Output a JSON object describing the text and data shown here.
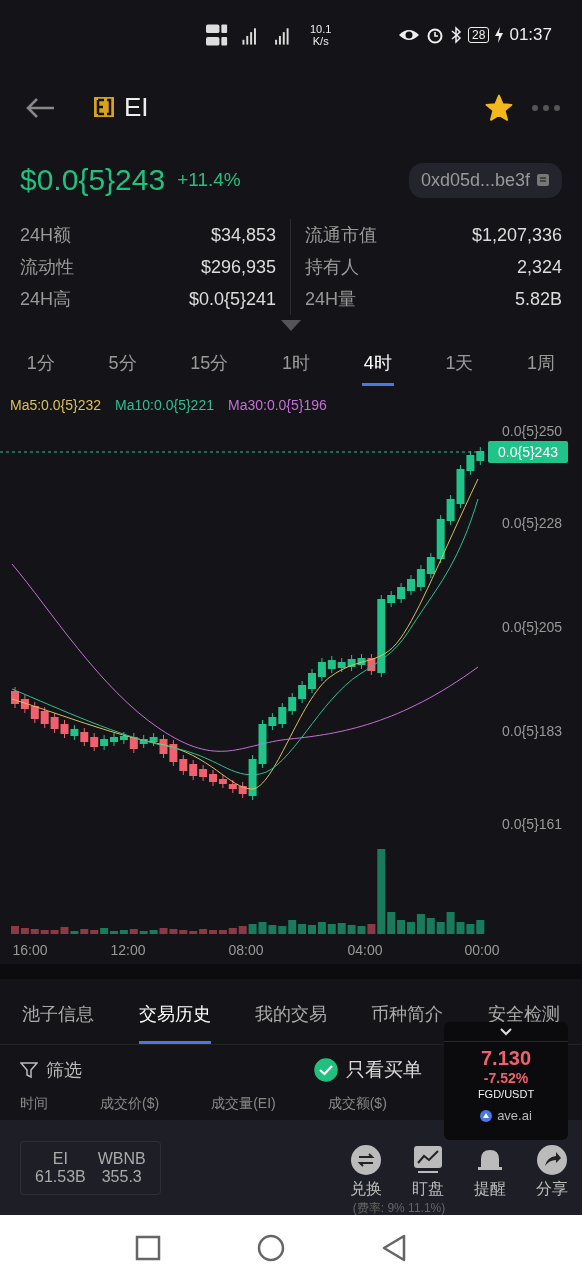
{
  "status_bar": {
    "network_speed": "10.1",
    "network_unit": "K/s",
    "battery": "28",
    "time": "01:37"
  },
  "header": {
    "token_symbol": "EI",
    "favorited": true
  },
  "price": {
    "value": "$0.0{5}243",
    "change": "+11.4%",
    "address": "0xd05d...be3f"
  },
  "stats": [
    {
      "label": "24H额",
      "value": "$34,853"
    },
    {
      "label": "流通市值",
      "value": "$1,207,336"
    },
    {
      "label": "流动性",
      "value": "$296,935"
    },
    {
      "label": "持有人",
      "value": "2,324"
    },
    {
      "label": "24H高",
      "value": "$0.0{5}241"
    },
    {
      "label": "24H量",
      "value": "5.82B"
    }
  ],
  "intervals": [
    {
      "label": "1分",
      "selected": false
    },
    {
      "label": "5分",
      "selected": false
    },
    {
      "label": "15分",
      "selected": false
    },
    {
      "label": "1时",
      "selected": false
    },
    {
      "label": "4时",
      "selected": true
    },
    {
      "label": "1天",
      "selected": false
    },
    {
      "label": "1周",
      "selected": false
    }
  ],
  "moving_averages": [
    {
      "label": "Ma5:0.0{5}232",
      "color": "#d9c15a"
    },
    {
      "label": "Ma10:0.0{5}221",
      "color": "#2fbf8f"
    },
    {
      "label": "Ma30:0.0{5}196",
      "color": "#c46fd6"
    }
  ],
  "chart": {
    "price_labels": [
      "0.0{5}250",
      "0.0{5}228",
      "0.0{5}205",
      "0.0{5}183",
      "0.0{5}161"
    ],
    "current_price": "0.0{5}243",
    "time_labels": [
      "16:00",
      "12:00",
      "08:00",
      "04:00",
      "00:00"
    ]
  },
  "detail_tabs": [
    {
      "label": "池子信息",
      "selected": false
    },
    {
      "label": "交易历史",
      "selected": true
    },
    {
      "label": "我的交易",
      "selected": false
    },
    {
      "label": "币种简介",
      "selected": false
    },
    {
      "label": "安全检测",
      "selected": false
    }
  ],
  "filter": {
    "label": "筛选",
    "buy_only_label": "只看买单",
    "buy_only": true
  },
  "columns": [
    "时间",
    "成交价($)",
    "成交量(EI)",
    "成交额($)"
  ],
  "balances": [
    {
      "symbol": "EI",
      "amount": "61.53B"
    },
    {
      "symbol": "WBNB",
      "amount": "355.3"
    }
  ],
  "actions": [
    {
      "label": "兑换",
      "kind": "swap"
    },
    {
      "label": "盯盘",
      "kind": "chart"
    },
    {
      "label": "提醒",
      "kind": "bell"
    },
    {
      "label": "分享",
      "kind": "share"
    }
  ],
  "fee_note": "(费率: 9% 11.1%)",
  "floating_ticker": {
    "price": "7.130",
    "change": "-7.52%",
    "pair": "FGD/USDT",
    "brand": "ave.ai"
  }
}
